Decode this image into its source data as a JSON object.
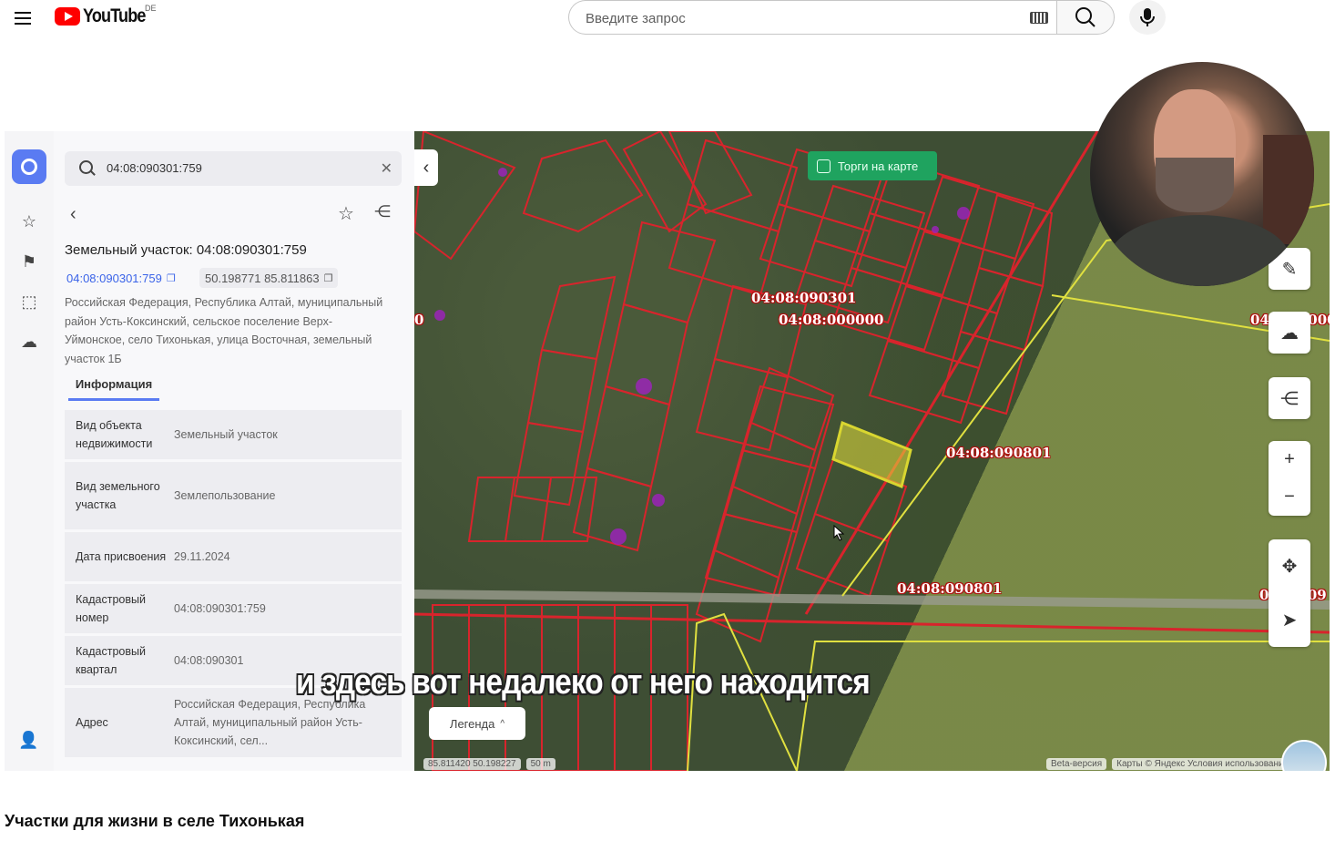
{
  "header": {
    "logo_text": "YouTube",
    "country_code": "DE",
    "search_placeholder": "Введите запрос"
  },
  "map_app": {
    "search_query": "04:08:090301:759",
    "parcel_title": "Земельный участок: 04:08:090301:759",
    "cadastral_link": "04:08:090301:759",
    "coordinates": "50.198771 85.811863",
    "address": "Российская Федерация, Республика Алтай, муниципальный район Усть-Коксинский, сельское поселение Верх-Уймонское, село Тихонькая, улица Восточная, земельный участок 1Б",
    "tab_info": "Информация",
    "rows": [
      {
        "key": "Вид объекта недвижимости",
        "value": "Земельный участок"
      },
      {
        "key": "Вид земельного участка",
        "value": "Землепользование"
      },
      {
        "key": "Дата присвоения",
        "value": "29.11.2024"
      },
      {
        "key": "Кадастровый номер",
        "value": "04:08:090301:759"
      },
      {
        "key": "Кадастровый квартал",
        "value": "04:08:090301"
      },
      {
        "key": "Адрес",
        "value": "Российская Федерация, Республика Алтай, муниципальный район Усть-Коксинский, сел..."
      }
    ],
    "torgi_label": "Торги на карте",
    "legend_label": "Легенда",
    "map_labels": {
      "l1": "04:08:090301",
      "l2": "04:08:000000",
      "l3": "04:08:090801",
      "l4": "04:08:090801",
      "l5": "0",
      "l6": "04:08:0000",
      "l7": "04:08:09"
    },
    "bottom_coords": "85.811420 50.198227",
    "scale": "50 m",
    "beta": "Beta-версия",
    "attribution": "Карты © Яндекс  Условия использования"
  },
  "subtitle": "и здесь вот недалеко от него находится",
  "video_title": "Участки для жизни в селе Тихонькая",
  "colors": {
    "parcel_outline": "#d8242c",
    "selected_parcel": "#d9d630",
    "accent": "#5a7bf2",
    "torgi_green": "#1fa35f"
  }
}
